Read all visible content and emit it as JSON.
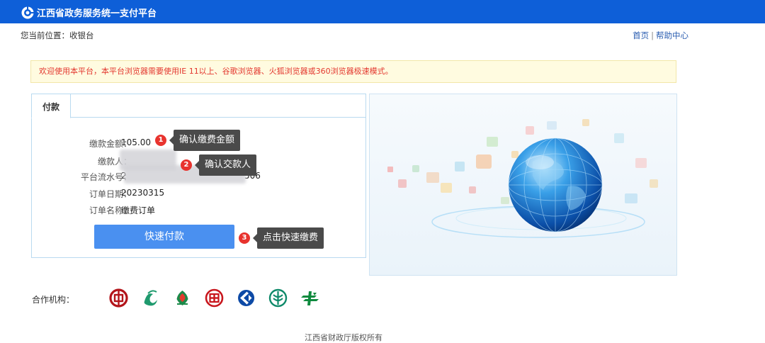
{
  "header": {
    "title": "江西省政务服务统一支付平台"
  },
  "breadcrumb": {
    "text": "您当前位置：收银台"
  },
  "top_links": {
    "home": "首页",
    "separator": "|",
    "help": "帮助中心"
  },
  "notice": {
    "text": "欢迎使用本平台，本平台浏览器需要使用IE 11以上、谷歌浏览器、火狐浏览器或360浏览器极速模式。"
  },
  "payment": {
    "tab_label": "付款",
    "fields": [
      {
        "label": "缴款金额：",
        "value": "105.00"
      },
      {
        "label": "缴款人：",
        "value": ""
      },
      {
        "label": "平台流水号：",
        "value": "2",
        "value_suffix": "506"
      },
      {
        "label": "订单日期：",
        "value": "20230315"
      },
      {
        "label": "订单名称：",
        "value": "缴费订单"
      }
    ],
    "pay_button": "快速付款"
  },
  "tips": [
    {
      "number": "1",
      "text": "确认缴费金额"
    },
    {
      "number": "2",
      "text": "确认交款人"
    },
    {
      "number": "3",
      "text": "点击快速缴费"
    }
  ],
  "partners": {
    "label": "合作机构：",
    "items": [
      "bank-of-china-icon",
      "rural-credit-icon",
      "agricultural-bank-icon",
      "icbc-icon",
      "construction-bank-icon",
      "abc-icon",
      "postal-savings-icon"
    ]
  },
  "footer": {
    "text": "江西省财政厅版权所有"
  },
  "colors": {
    "header_bg": "#0e5fd8",
    "button_bg": "#4a90f0",
    "notice_text": "#e3382f",
    "badge": "#e8332e"
  }
}
